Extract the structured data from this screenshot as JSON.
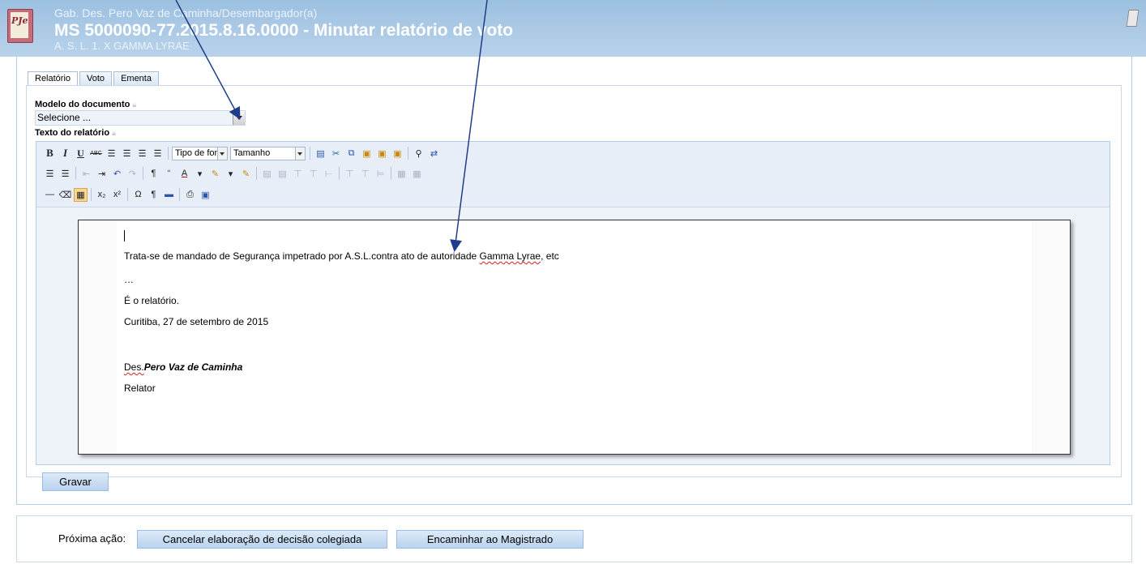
{
  "header": {
    "logo_text": "PJe",
    "org": "Gab. Des. Pero Vaz de Caminha/Desembargador(a)",
    "title": "MS 5000090-77.2015.8.16.0000 - Minutar relatório de voto",
    "parties": "A. S. L. 1. X GAMMA LYRAE"
  },
  "tabs": [
    {
      "label": "Relatório",
      "active": true
    },
    {
      "label": "Voto",
      "active": false
    },
    {
      "label": "Ementa",
      "active": false
    }
  ],
  "form": {
    "model_label": "Modelo do documento",
    "model_value": "Selecione ...",
    "text_label": "Texto do relatório"
  },
  "toolbar": {
    "font_select": "Tipo de fonte",
    "size_select": "Tamanho"
  },
  "document": {
    "line1_a": "Trata-se de mandado de Segurança impetrado por A.S.L.contra ato de autoridade ",
    "line1_b": "Gamma Lyrae",
    "line1_c": ", etc",
    "ellipsis": "…",
    "line3": "É o relatório.",
    "line4": "Curitiba, 27 de setembro de 2015",
    "sig_prefix": "Des.",
    "sig_name": "Pero Vaz de Caminha",
    "sig_role": "Relator"
  },
  "buttons": {
    "save": "Gravar",
    "next_label": "Próxima ação:",
    "cancel": "Cancelar elaboração de decisão colegiada",
    "forward": "Encaminhar ao Magistrado"
  },
  "colors": {
    "header_bg": "#9cc0e0",
    "button_bg": "#c6dcf2",
    "arrow": "#1f3d8a"
  }
}
